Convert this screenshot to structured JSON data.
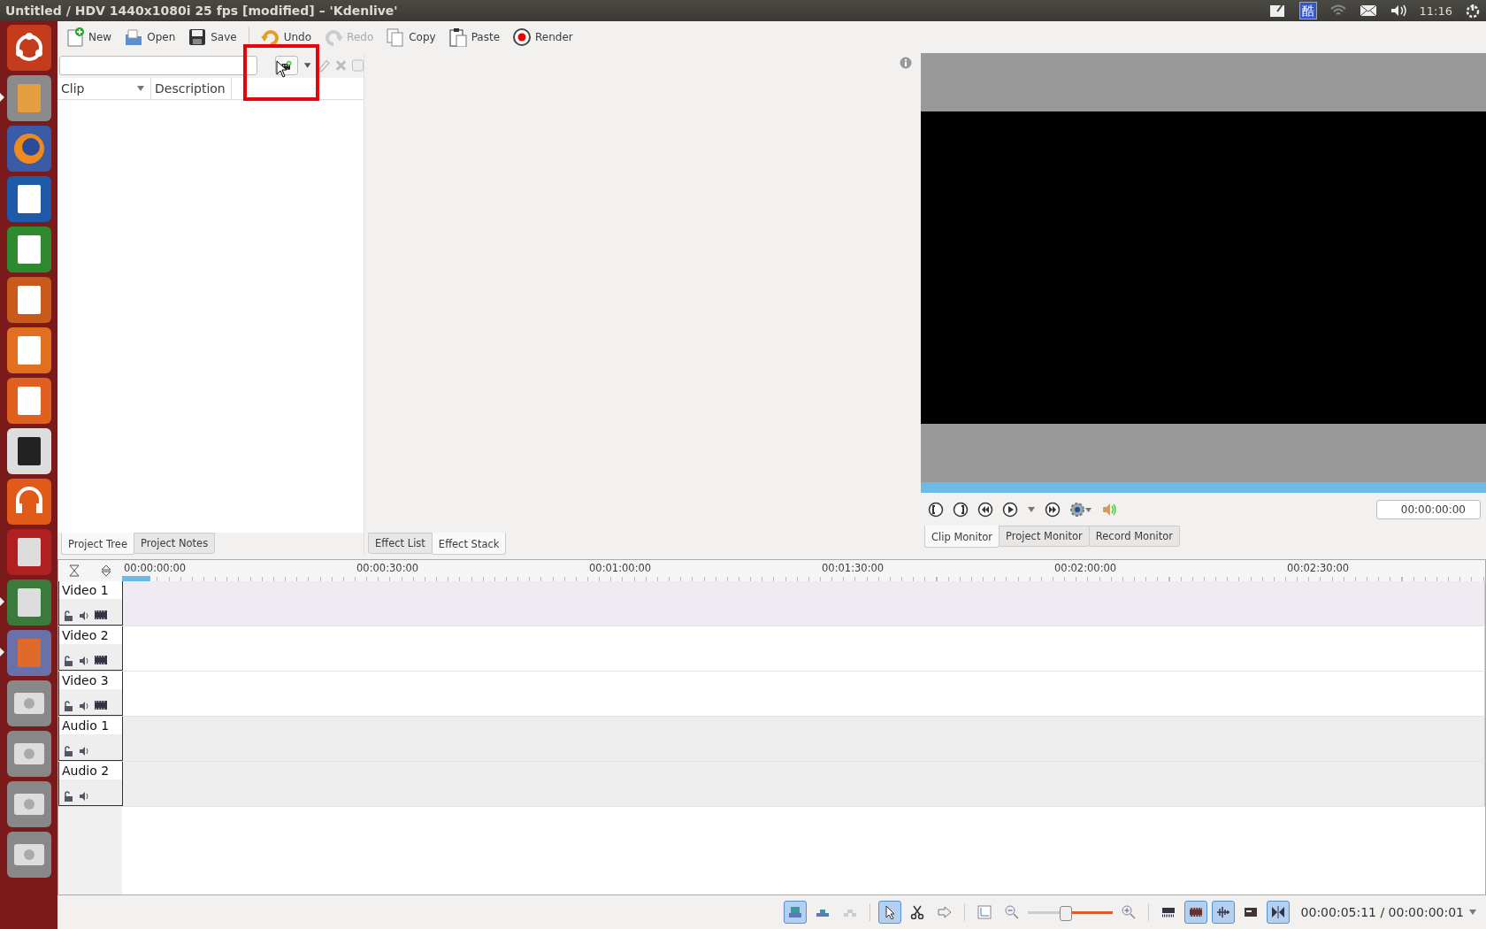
{
  "top_panel": {
    "title": "Untitled / HDV 1440x1080i 25 fps [modified] – 'Kdenlive'",
    "tray": [
      {
        "kind": "note"
      },
      {
        "kind": "input-method",
        "label": "酷"
      },
      {
        "kind": "wifi"
      },
      {
        "kind": "mail"
      },
      {
        "kind": "volume"
      }
    ],
    "clock": "11:16"
  },
  "launcher": [
    {
      "kind": "ubuntu",
      "running": false
    },
    {
      "kind": "files",
      "running": true
    },
    {
      "kind": "firefox",
      "running": false
    },
    {
      "kind": "writer",
      "running": false
    },
    {
      "kind": "calc",
      "running": false
    },
    {
      "kind": "impress",
      "running": false
    },
    {
      "kind": "store",
      "running": false
    },
    {
      "kind": "ubuntu-one",
      "running": false
    },
    {
      "kind": "amazon",
      "running": false
    },
    {
      "kind": "headphones",
      "running": false
    },
    {
      "kind": "tools",
      "running": false
    },
    {
      "kind": "updater",
      "running": true
    },
    {
      "kind": "kdenlive",
      "running": true
    },
    {
      "kind": "drive",
      "running": false
    },
    {
      "kind": "drive",
      "running": false
    },
    {
      "kind": "drive",
      "running": false
    },
    {
      "kind": "drive",
      "running": false
    }
  ],
  "toolbar": [
    {
      "kind": "new",
      "label": "New",
      "disabled": false
    },
    {
      "kind": "open",
      "label": "Open",
      "disabled": false
    },
    {
      "kind": "save",
      "label": "Save",
      "disabled": false
    },
    {
      "kind": "separator"
    },
    {
      "kind": "undo",
      "label": "Undo",
      "disabled": false
    },
    {
      "kind": "redo",
      "label": "Redo",
      "disabled": true
    },
    {
      "kind": "copy",
      "label": "Copy",
      "disabled": false
    },
    {
      "kind": "paste",
      "label": "Paste",
      "disabled": false
    },
    {
      "kind": "render",
      "label": "Render",
      "disabled": false
    }
  ],
  "project_bin": {
    "tools": [
      {
        "kind": "add-clip",
        "disabled": false
      },
      {
        "kind": "caret",
        "disabled": false
      },
      {
        "kind": "edit",
        "disabled": true
      },
      {
        "kind": "delete",
        "disabled": true
      },
      {
        "kind": "checkbox",
        "disabled": true
      }
    ],
    "columns": [
      {
        "label": "Clip",
        "sortable": true
      },
      {
        "label": "Description",
        "sortable": false
      }
    ],
    "tabs": [
      {
        "label": "Project Tree",
        "selected": true
      },
      {
        "label": "Project Notes",
        "selected": false
      }
    ]
  },
  "effects": {
    "tabs": [
      {
        "label": "Effect List",
        "selected": false
      },
      {
        "label": "Effect Stack",
        "selected": true
      }
    ]
  },
  "monitor": {
    "progress": {
      "level": 1
    },
    "controls": [
      {
        "kind": "in"
      },
      {
        "kind": "out"
      },
      {
        "kind": "rewind"
      },
      {
        "kind": "play"
      },
      {
        "kind": "caret"
      },
      {
        "kind": "forward"
      },
      {
        "kind": "settings"
      },
      {
        "kind": "volume"
      }
    ],
    "timecode": "00:00:00:00",
    "tabs": [
      {
        "label": "Clip Monitor",
        "selected": true
      },
      {
        "label": "Project Monitor",
        "selected": false
      },
      {
        "label": "Record Monitor",
        "selected": false
      }
    ]
  },
  "timeline": {
    "ruler": [
      "00:00:00:00",
      "00:00:30:00",
      "00:01:00:00",
      "00:01:30:00",
      "00:02:00:00",
      "00:02:30:00"
    ],
    "tracks": [
      {
        "name": "Video 1",
        "kind": "video",
        "color": "#f0eaf2"
      },
      {
        "name": "Video 2",
        "kind": "video",
        "color": "#ffffff"
      },
      {
        "name": "Video 3",
        "kind": "video",
        "color": "#ffffff"
      },
      {
        "name": "Audio 1",
        "kind": "audio",
        "color": "#eeeeee"
      },
      {
        "name": "Audio 2",
        "kind": "audio",
        "color": "#eeeeee"
      }
    ]
  },
  "status_bar": {
    "tools": [
      {
        "kind": "track-normal",
        "selected": true
      },
      {
        "kind": "track-overwrite",
        "selected": false
      },
      {
        "kind": "track-insert",
        "selected": false,
        "disabled": true
      },
      {
        "kind": "separator"
      },
      {
        "kind": "select",
        "selected": true
      },
      {
        "kind": "razor",
        "selected": false
      },
      {
        "kind": "spacer",
        "selected": false
      },
      {
        "kind": "separator"
      },
      {
        "kind": "fit",
        "selected": false
      },
      {
        "kind": "zoom-out",
        "selected": false
      },
      {
        "kind": "zoom-slider",
        "level": 0.44
      },
      {
        "kind": "zoom-in",
        "selected": false
      },
      {
        "kind": "separator"
      },
      {
        "kind": "video-thumbs",
        "selected": false
      },
      {
        "kind": "clip-thumbs",
        "selected": true
      },
      {
        "kind": "audio-thumbs",
        "selected": true
      },
      {
        "kind": "markers",
        "selected": false
      },
      {
        "kind": "snap",
        "selected": true
      }
    ],
    "timecode": "00:00:05:11 / 00:00:00:01"
  },
  "annotation": {
    "kind": "rectangle"
  },
  "cursor": {
    "kind": "arrow"
  }
}
